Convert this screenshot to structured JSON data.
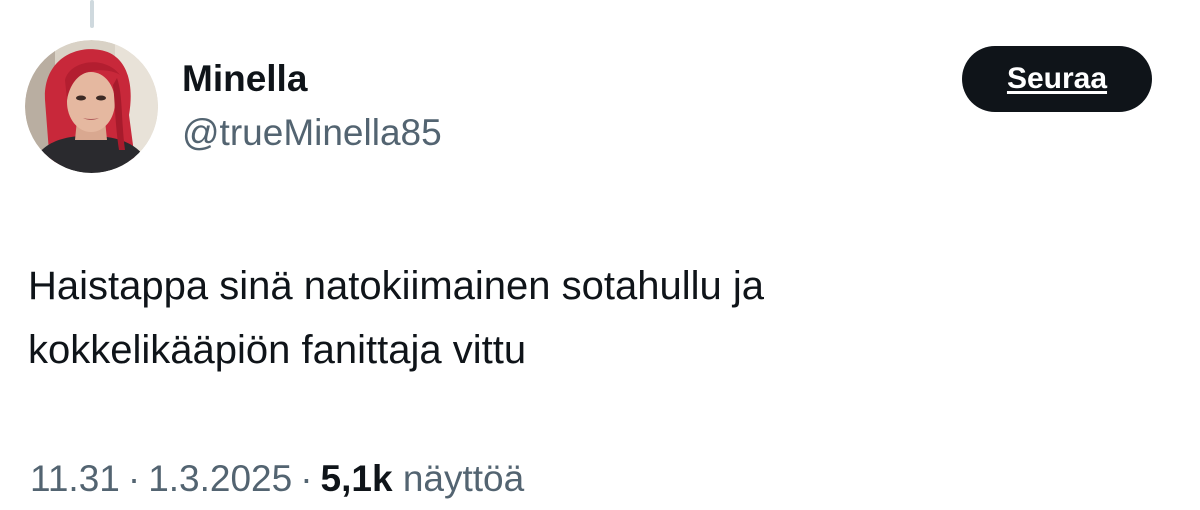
{
  "author": {
    "display_name": "Minella",
    "handle": "@trueMinella85",
    "avatar_icon": "profile-photo-avatar"
  },
  "follow_button": {
    "label": "Seuraa"
  },
  "tweet": {
    "lines": [
      "Haistappa sinä natokiimainen sotahullu ja",
      "kokkelikääpiön fanittaja vittu"
    ]
  },
  "meta": {
    "time": "11.31",
    "separator": "·",
    "date": "1.3.2025",
    "views_count": "5,1k",
    "views_label": "näyttöä"
  },
  "colors": {
    "text_primary": "#0f1419",
    "text_secondary": "#536471",
    "button_bg": "#0f1419",
    "thread_line": "#cfd9de"
  }
}
